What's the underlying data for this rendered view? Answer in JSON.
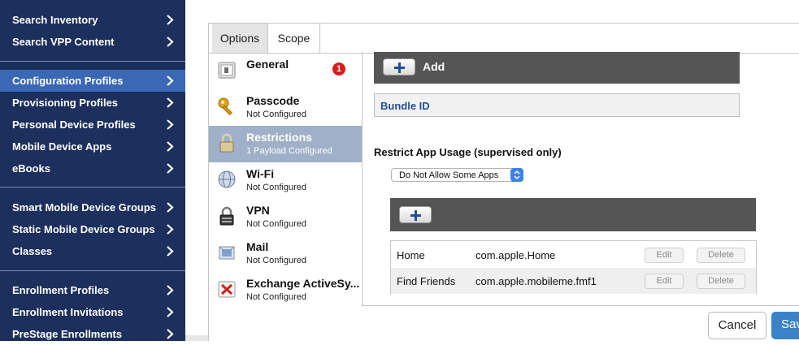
{
  "sidebar": {
    "group1": [
      {
        "label": "Search Inventory"
      },
      {
        "label": "Search VPP Content"
      }
    ],
    "group2": [
      {
        "label": "Configuration Profiles",
        "active": true
      },
      {
        "label": "Provisioning Profiles"
      },
      {
        "label": "Personal Device Profiles"
      },
      {
        "label": "Mobile Device Apps"
      },
      {
        "label": "eBooks"
      }
    ],
    "group3": [
      {
        "label": "Smart Mobile Device Groups"
      },
      {
        "label": "Static Mobile Device Groups"
      },
      {
        "label": "Classes"
      }
    ],
    "group4": [
      {
        "label": "Enrollment Profiles"
      },
      {
        "label": "Enrollment Invitations"
      },
      {
        "label": "PreStage Enrollments"
      }
    ]
  },
  "tabs": {
    "options": "Options",
    "scope": "Scope"
  },
  "payloads": [
    {
      "title": "General",
      "subtitle": "",
      "icon": "general-icon",
      "badge": "1"
    },
    {
      "title": "Passcode",
      "subtitle": "Not Configured",
      "icon": "key-icon"
    },
    {
      "title": "Restrictions",
      "subtitle": "1 Payload Configured",
      "icon": "padlock-icon",
      "active": true
    },
    {
      "title": "Wi-Fi",
      "subtitle": "Not Configured",
      "icon": "globe-icon"
    },
    {
      "title": "VPN",
      "subtitle": "Not Configured",
      "icon": "vpn-lock-icon"
    },
    {
      "title": "Mail",
      "subtitle": "Not Configured",
      "icon": "mail-icon"
    },
    {
      "title": "Exchange ActiveSy...",
      "subtitle": "Not Configured",
      "icon": "exchange-icon"
    }
  ],
  "content": {
    "add_label": "Add",
    "bundle_id_label": "Bundle ID",
    "restrict_label": "Restrict App Usage (supervised only)",
    "usage_select_value": "Do Not Allow Some Apps",
    "apps": [
      {
        "name": "Home",
        "bundle": "com.apple.Home",
        "edit": "Edit",
        "delete": "Delete"
      },
      {
        "name": "Find Friends",
        "bundle": "com.apple.mobileme.fmf1",
        "edit": "Edit",
        "delete": "Delete"
      }
    ]
  },
  "footer": {
    "cancel": "Cancel",
    "save": "Save"
  },
  "colors": {
    "sidebar_bg": "#1c2f5d",
    "sidebar_active": "#3a68b4",
    "payload_active": "#9fb0c8",
    "dark_bar": "#555555",
    "link_blue": "#1f4f9a",
    "save_blue": "#3b82c8",
    "badge_red": "#d61a1a"
  }
}
